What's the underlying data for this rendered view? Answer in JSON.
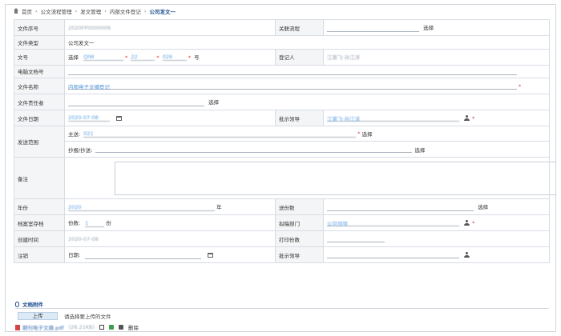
{
  "breadcrumb": [
    "首页",
    "公文流程管理",
    "发文管理",
    "内部文件登记",
    "公司发文一"
  ],
  "labels": {
    "doc_no": "文件序号",
    "related_flow": "关联流程",
    "doc_type": "文件类型",
    "wen_hao": "文号",
    "registrar": "登记人",
    "e_doc_no": "电脑文档号",
    "doc_title": "文件名称",
    "responsible": "文件责任者",
    "doc_date": "文件日期",
    "approver": "批示领导",
    "scope": "发送范围",
    "remark": "备注",
    "year": "年份",
    "copies_count": "送份数",
    "archive": "档案室存档",
    "reply_dept": "拟稿部门",
    "created": "创建时间",
    "print_copies": "打印份数",
    "cancel": "注销",
    "approver2": "批示领导"
  },
  "values": {
    "doc_no": "2020FP0000006",
    "doc_type": "公司发文一",
    "wen_hao_select": "选择",
    "wen_hao_1": "QIW",
    "wen_hao_2": "22",
    "wen_hao_3": "026",
    "wen_hao_suffix": "号",
    "registrar": "江第飞·孙江洋",
    "doc_title": "内部电子文摘登记",
    "doc_date": "2020-07-08",
    "approver": "江第飞·孙江洋",
    "scope_main_label": "主送:",
    "scope_main_value": "021",
    "scope_cc_label": "抄报/抄送:",
    "year": "2020",
    "year_unit": "年",
    "archive_label": "份数:",
    "archive_value": "1",
    "archive_unit": "份",
    "reply_dept": "公司领导",
    "created": "2020-07-08",
    "cancel_date_label": "日期:"
  },
  "select_label": "选择",
  "attachments": {
    "title": "文档附件",
    "upload_button": "上传",
    "upload_hint": "请选择要上传的文件",
    "file_name": "期刊电子文摘.pdf",
    "file_size": "(28.21KB)",
    "delete_label": "删除"
  }
}
